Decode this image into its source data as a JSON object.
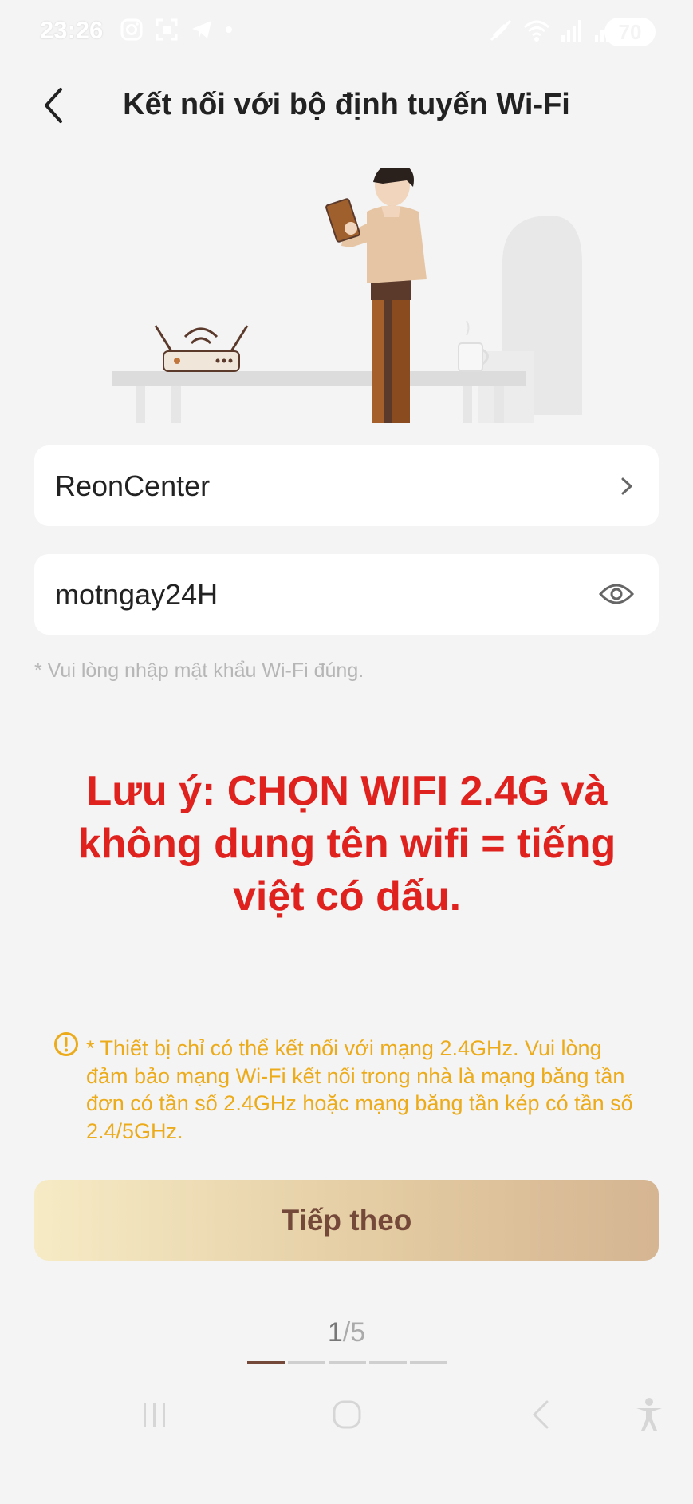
{
  "status_bar": {
    "time": "23:26",
    "battery_level": "70",
    "left_icons": [
      "instagram-icon",
      "scan-icon",
      "telegram-icon",
      "dot-icon"
    ],
    "right_icons": [
      "mute-icon",
      "wifi-icon",
      "signal-icon",
      "signal-icon"
    ]
  },
  "header": {
    "back_icon": "chevron-left-icon",
    "title": "Kết nối với bộ định tuyến Wi-Fi"
  },
  "form": {
    "ssid": {
      "value": "ReonCenter",
      "icon": "chevron-right-icon"
    },
    "password": {
      "value": "motngay24H",
      "icon": "eye-icon"
    },
    "hint": "* Vui lòng nhập mật khẩu Wi-Fi đúng."
  },
  "notice": {
    "line1": "Lưu ý: CHỌN WIFI 2.4G và",
    "line2": "không dung tên wifi = tiếng",
    "line3": "việt có dấu.",
    "color": "#e0221f"
  },
  "warning": {
    "icon": "warning-circle-icon",
    "text": "* Thiết bị chỉ có thể kết nối với mạng 2.4GHz. Vui lòng đảm bảo mạng Wi-Fi kết nối trong nhà là mạng băng tần đơn có tần số 2.4GHz hoặc mạng băng tần kép có tần số 2.4/5GHz.",
    "color": "#ecab1a"
  },
  "next_button": {
    "label": "Tiếp theo"
  },
  "pagination": {
    "current": "1",
    "total": "/5",
    "steps": 5,
    "active_step": 1
  },
  "nav_bar": {
    "icons": [
      "recent-apps-icon",
      "home-icon",
      "back-icon",
      "accessibility-icon"
    ]
  },
  "colors": {
    "accent": "#75493a",
    "background": "#f4f4f4",
    "card": "#ffffff"
  }
}
